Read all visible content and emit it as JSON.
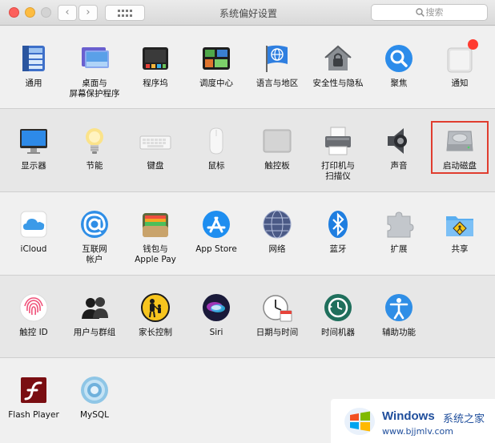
{
  "window": {
    "title": "系统偏好设置",
    "search_placeholder": "搜索",
    "back": "‹",
    "forward": "›"
  },
  "sections": [
    {
      "items": [
        {
          "label": "通用"
        },
        {
          "label": "桌面与\n屏幕保护程序"
        },
        {
          "label": "程序坞"
        },
        {
          "label": "调度中心"
        },
        {
          "label": "语言与地区"
        },
        {
          "label": "安全性与隐私"
        },
        {
          "label": "聚焦"
        },
        {
          "label": "通知"
        }
      ]
    },
    {
      "items": [
        {
          "label": "显示器"
        },
        {
          "label": "节能"
        },
        {
          "label": "键盘"
        },
        {
          "label": "鼠标"
        },
        {
          "label": "触控板"
        },
        {
          "label": "打印机与\n扫描仪"
        },
        {
          "label": "声音"
        },
        {
          "label": "启动磁盘",
          "highlighted": true
        }
      ]
    },
    {
      "items": [
        {
          "label": "iCloud"
        },
        {
          "label": "互联网\n帐户"
        },
        {
          "label": "钱包与\nApple Pay"
        },
        {
          "label": "App Store"
        },
        {
          "label": "网络"
        },
        {
          "label": "蓝牙"
        },
        {
          "label": "扩展"
        },
        {
          "label": "共享"
        }
      ]
    },
    {
      "items": [
        {
          "label": "触控 ID"
        },
        {
          "label": "用户与群组"
        },
        {
          "label": "家长控制"
        },
        {
          "label": "Siri"
        },
        {
          "label": "日期与时间"
        },
        {
          "label": "时间机器"
        },
        {
          "label": "辅助功能"
        }
      ]
    },
    {
      "items": [
        {
          "label": "Flash Player"
        },
        {
          "label": "MySQL"
        }
      ]
    }
  ],
  "watermark": {
    "brand": "Windows",
    "suffix": "系统之家",
    "url": "www.bjjmlv.com"
  },
  "colors": {
    "highlight": "#e03d2f",
    "accent_blue": "#1f4e9c"
  }
}
